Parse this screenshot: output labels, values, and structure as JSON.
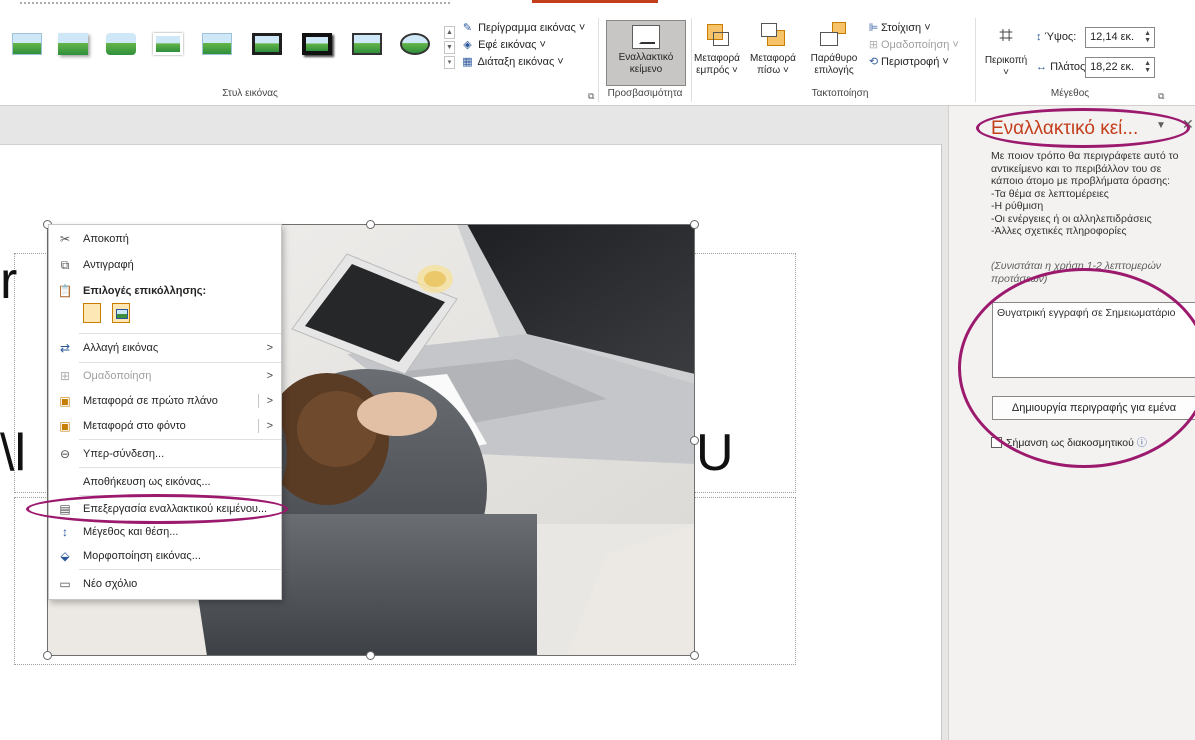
{
  "ribbon": {
    "picture_styles": {
      "group_label": "Στυλ εικόνας",
      "thumbnails": [
        "picture-style-1",
        "picture-style-2",
        "picture-style-3",
        "picture-style-4",
        "picture-style-5",
        "picture-style-6",
        "picture-style-7",
        "picture-style-8",
        "picture-style-9"
      ],
      "border_label": "Περίγραμμα εικόνας",
      "effects_label": "Εφέ εικόνας",
      "layout_label": "Διάταξη εικόνας"
    },
    "accessibility": {
      "group_label": "Προσβασιμότητα",
      "alt_text_line1": "Εναλλακτικό",
      "alt_text_line2": "κείμενο"
    },
    "arrange": {
      "group_label": "Τακτοποίηση",
      "bring_forward_line1": "Μεταφορά",
      "bring_forward_line2": "εμπρός",
      "send_backward_line1": "Μεταφορά",
      "send_backward_line2": "πίσω",
      "selection_pane_line1": "Παράθυρο",
      "selection_pane_line2": "επιλογής",
      "align_label": "Στοίχιση",
      "group_cmd_label": "Ομαδοποίηση",
      "rotate_label": "Περιστροφή"
    },
    "size": {
      "group_label": "Μέγεθος",
      "crop_label": "Περικοπή",
      "height_label": "Ύψος:",
      "height_value": "12,14 εκ.",
      "width_label": "Πλάτος:",
      "width_value": "18,22 εκ."
    }
  },
  "slide": {
    "text_fragment_1": "r",
    "text_fragment_2": "\\l",
    "text_fragment_3": "U"
  },
  "context_menu": {
    "items": [
      {
        "icon": "scissors-icon",
        "label": "Αποκοπή"
      },
      {
        "icon": "copy-icon",
        "label": "Αντιγραφή"
      },
      {
        "icon": "paste-options-icon",
        "label": "Επιλογές επικόλλησης:"
      },
      {
        "icon": "change-picture-icon",
        "label": "Αλλαγή εικόνας"
      },
      {
        "icon": "group-icon",
        "label": "Ομαδοποίηση"
      },
      {
        "icon": "bring-to-front-icon",
        "label": "Μεταφορά σε πρώτο πλάνο"
      },
      {
        "icon": "send-to-back-icon",
        "label": "Μεταφορά στο φόντο"
      },
      {
        "icon": "link-icon",
        "label": "Υπερ-σύνδεση..."
      },
      {
        "icon": "",
        "label": "Αποθήκευση ως εικόνας..."
      },
      {
        "icon": "alt-text-icon",
        "label": "Επεξεργασία εναλλακτικού κειμένου..."
      },
      {
        "icon": "size-position-icon",
        "label": "Μέγεθος και θέση..."
      },
      {
        "icon": "format-picture-icon",
        "label": "Μορφοποίηση εικόνας..."
      },
      {
        "icon": "new-comment-icon",
        "label": "Νέο σχόλιο"
      }
    ]
  },
  "alt_text_pane": {
    "title": "Εναλλακτικό κεί...",
    "description_lines": [
      "Με ποιον τρόπο θα περιγράφετε αυτό το",
      "αντικείμενο και το περιβάλλον του σε",
      "κάποιο άτομο με προβλήματα όρασης:",
      "-Τα θέμα σε λεπτομέρειες",
      "-Η ρύθμιση",
      "-Οι ενέργειες ή οι αλληλεπιδράσεις",
      "-Άλλες σχετικές πληροφορίες"
    ],
    "hint_line1": "(Συνιστάται η χρήση 1-2 λεπτομερών",
    "hint_line2": "προτάσεων)",
    "input_value": "Θυγατρική εγγραφή σε Σημειωματάριο",
    "generate_button": "Δημιουργία περιγραφής για εμένα",
    "decorative_label": "Σήμανση ως διακοσμητικού"
  },
  "colors": {
    "accent": "#c43e1c",
    "annotation": "#9c1a6e"
  }
}
